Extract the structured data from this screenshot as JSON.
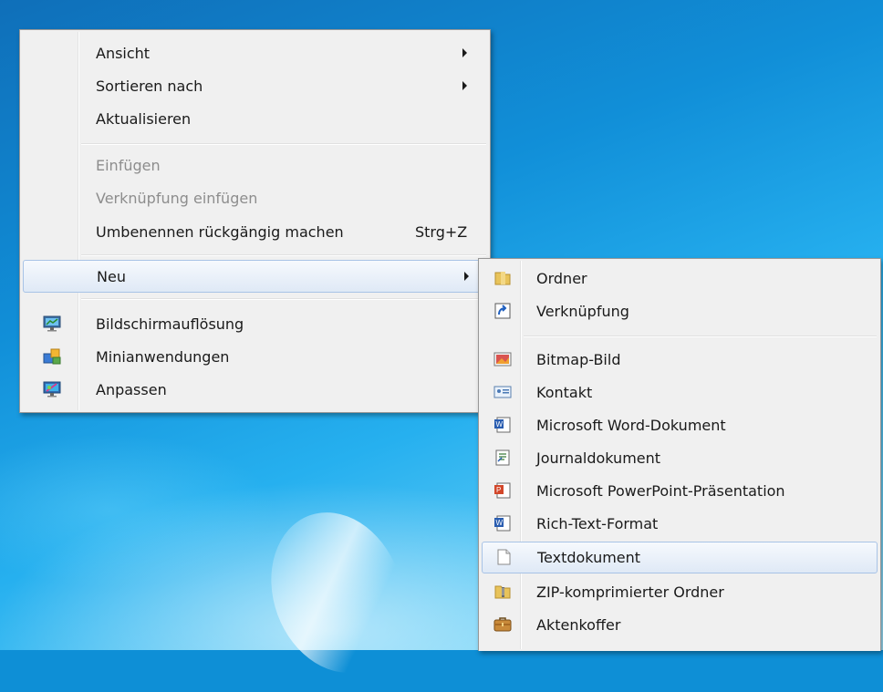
{
  "context_menu": {
    "items": {
      "view": {
        "label": "Ansicht"
      },
      "sort": {
        "label": "Sortieren nach"
      },
      "refresh": {
        "label": "Aktualisieren"
      },
      "paste": {
        "label": "Einfügen"
      },
      "paste_shortcut": {
        "label": "Verknüpfung einfügen"
      },
      "undo_rename": {
        "label": "Umbenennen rückgängig machen",
        "shortcut": "Strg+Z"
      },
      "new": {
        "label": "Neu"
      },
      "screen_resolution": {
        "label": "Bildschirmauflösung"
      },
      "gadgets": {
        "label": "Minianwendungen"
      },
      "personalize": {
        "label": "Anpassen"
      }
    }
  },
  "new_submenu": {
    "items": {
      "folder": {
        "label": "Ordner"
      },
      "shortcut": {
        "label": "Verknüpfung"
      },
      "bitmap": {
        "label": "Bitmap-Bild"
      },
      "contact": {
        "label": "Kontakt"
      },
      "word": {
        "label": "Microsoft Word-Dokument"
      },
      "journal": {
        "label": "Journaldokument"
      },
      "powerpoint": {
        "label": "Microsoft PowerPoint-Präsentation"
      },
      "rtf": {
        "label": "Rich-Text-Format"
      },
      "text": {
        "label": "Textdokument"
      },
      "zip": {
        "label": "ZIP-komprimierter Ordner"
      },
      "briefcase": {
        "label": "Aktenkoffer"
      }
    }
  },
  "colors": {
    "menu_bg": "#f0f0f0",
    "hover_border": "#a8c3e6",
    "disabled_text": "#8d8d8d",
    "desktop_blue": "#118fd8"
  }
}
